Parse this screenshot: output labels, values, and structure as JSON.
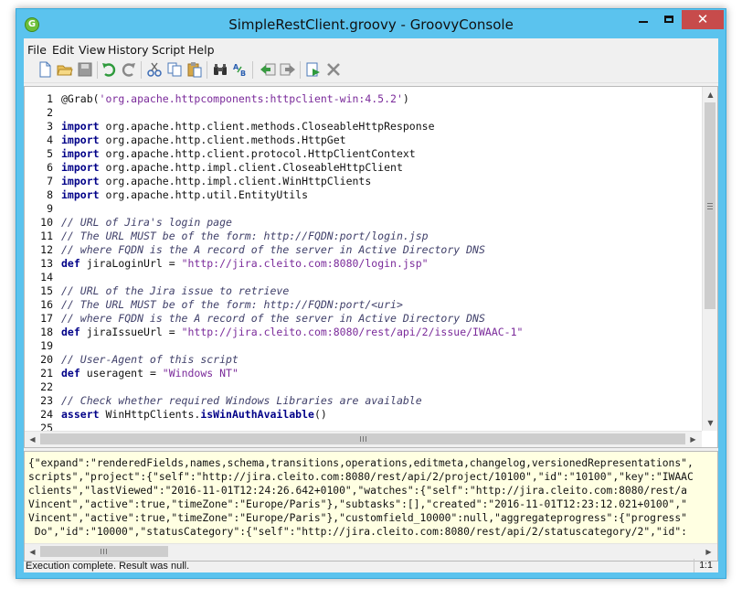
{
  "window": {
    "title": "SimpleRestClient.groovy - GroovyConsole",
    "close_glyph": "✕"
  },
  "menubar": [
    "File",
    "Edit",
    "View",
    "History",
    "Script",
    "Help"
  ],
  "toolbar": [
    "new-file",
    "open-file",
    "save",
    "undo",
    "redo",
    "cut",
    "copy",
    "paste",
    "find",
    "replace",
    "previous",
    "next",
    "run",
    "interrupt"
  ],
  "editor": {
    "lines": [
      [
        [
          "@Grab(",
          "pl"
        ],
        [
          "'org.apache.httpcomponents:httpclient-win:4.5.2'",
          "str"
        ],
        [
          ")",
          "pl"
        ]
      ],
      [],
      [
        [
          "import",
          "kw"
        ],
        [
          " org.apache.http.client.methods.CloseableHttpResponse",
          "pl"
        ]
      ],
      [
        [
          "import",
          "kw"
        ],
        [
          " org.apache.http.client.methods.HttpGet",
          "pl"
        ]
      ],
      [
        [
          "import",
          "kw"
        ],
        [
          " org.apache.http.client.protocol.HttpClientContext",
          "pl"
        ]
      ],
      [
        [
          "import",
          "kw"
        ],
        [
          " org.apache.http.impl.client.CloseableHttpClient",
          "pl"
        ]
      ],
      [
        [
          "import",
          "kw"
        ],
        [
          " org.apache.http.impl.client.WinHttpClients",
          "pl"
        ]
      ],
      [
        [
          "import",
          "kw"
        ],
        [
          " org.apache.http.util.EntityUtils",
          "pl"
        ]
      ],
      [],
      [
        [
          "// URL of Jira's login page",
          "cm"
        ]
      ],
      [
        [
          "// The URL MUST be of the form: http://FQDN:port/login.jsp",
          "cm"
        ]
      ],
      [
        [
          "// where FQDN is the A record of the server in Active Directory DNS",
          "cm"
        ]
      ],
      [
        [
          "def",
          "kw"
        ],
        [
          " jiraLoginUrl = ",
          "pl"
        ],
        [
          "\"http://jira.cleito.com:8080/login.jsp\"",
          "str"
        ]
      ],
      [],
      [
        [
          "// URL of the Jira issue to retrieve",
          "cm"
        ]
      ],
      [
        [
          "// The URL MUST be of the form: http://FQDN:port/<uri>",
          "cm"
        ]
      ],
      [
        [
          "// where FQDN is the A record of the server in Active Directory DNS",
          "cm"
        ]
      ],
      [
        [
          "def",
          "kw"
        ],
        [
          " jiraIssueUrl = ",
          "pl"
        ],
        [
          "\"http://jira.cleito.com:8080/rest/api/2/issue/IWAAC-1\"",
          "str"
        ]
      ],
      [],
      [
        [
          "// User-Agent of this script",
          "cm"
        ]
      ],
      [
        [
          "def",
          "kw"
        ],
        [
          " useragent = ",
          "pl"
        ],
        [
          "\"Windows NT\"",
          "str"
        ]
      ],
      [],
      [
        [
          "// Check whether required Windows Libraries are available",
          "cm"
        ]
      ],
      [
        [
          "assert",
          "kw"
        ],
        [
          " WinHttpClients.",
          "pl"
        ],
        [
          "isWinAuthAvailable",
          "kw"
        ],
        [
          "()",
          "pl"
        ]
      ],
      []
    ]
  },
  "output": {
    "lines": [
      "{\"expand\":\"renderedFields,names,schema,transitions,operations,editmeta,changelog,versionedRepresentations\",",
      "scripts\",\"project\":{\"self\":\"http://jira.cleito.com:8080/rest/api/2/project/10100\",\"id\":\"10100\",\"key\":\"IWAAC",
      "clients\",\"lastViewed\":\"2016-11-01T12:24:26.642+0100\",\"watches\":{\"self\":\"http://jira.cleito.com:8080/rest/a",
      "Vincent\",\"active\":true,\"timeZone\":\"Europe/Paris\"},\"subtasks\":[],\"created\":\"2016-11-01T12:23:12.021+0100\",\"",
      "Vincent\",\"active\":true,\"timeZone\":\"Europe/Paris\"},\"customfield_10000\":null,\"aggregateprogress\":{\"progress\"",
      " Do\",\"id\":\"10000\",\"statusCategory\":{\"self\":\"http://jira.cleito.com:8080/rest/api/2/statuscategory/2\",\"id\":"
    ]
  },
  "statusbar": {
    "message": "Execution complete. Result was null.",
    "position": "1:1"
  }
}
